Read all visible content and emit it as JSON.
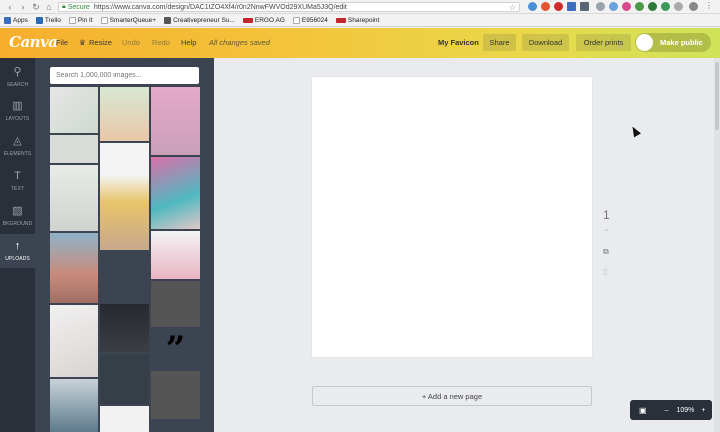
{
  "browser": {
    "secure_label": "Secure",
    "url": "https://www.canva.com/design/DAC1tZO4Xf4/r0n2NnwFWVOd29XUMa5J3Q/edit",
    "bookmarks": [
      "Apps",
      "Trello",
      "Pin It",
      "SmarterQueue+",
      "Creativepreneur Su...",
      "ERGO AG",
      "E956024",
      "Sharepoint"
    ]
  },
  "topbar": {
    "logo": "Canva",
    "file": "File",
    "resize": "Resize",
    "undo": "Undo",
    "redo": "Redo",
    "help": "Help",
    "saved_status": "All changes saved",
    "design_name": "My Favicon",
    "share": "Share",
    "download": "Download",
    "order_prints": "Order prints",
    "make_public": "Make public"
  },
  "sidebar": {
    "items": [
      {
        "label": "SEARCH",
        "icon": "search-icon"
      },
      {
        "label": "LAYOUTS",
        "icon": "layouts-icon"
      },
      {
        "label": "ELEMENTS",
        "icon": "elements-icon"
      },
      {
        "label": "TEXT",
        "icon": "text-icon"
      },
      {
        "label": "BKGROUND",
        "icon": "background-icon"
      },
      {
        "label": "UPLOADS",
        "icon": "upload-icon"
      }
    ],
    "active": "UPLOADS"
  },
  "panel": {
    "search_placeholder": "Search 1,000,000 images..."
  },
  "canvas": {
    "page_number": "1",
    "add_page": "+ Add a new page",
    "zoom": "109%",
    "zoom_minus": "–",
    "zoom_plus": "+"
  },
  "colors": {
    "accent_left": "#f6ae2d",
    "accent_right": "#cfe35a",
    "sidebar": "#293039",
    "panel": "#3b4450"
  }
}
